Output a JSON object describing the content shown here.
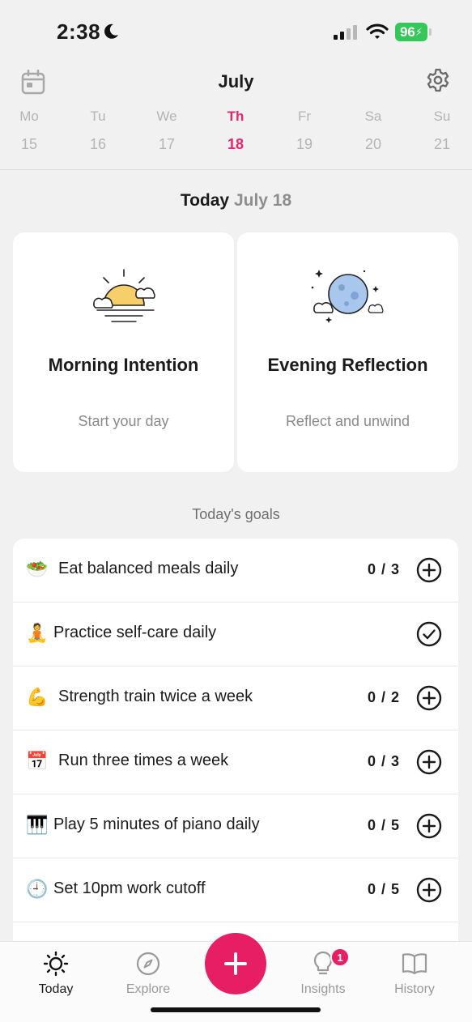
{
  "status_bar": {
    "time": "2:38",
    "battery": "96"
  },
  "header": {
    "month": "July"
  },
  "week": [
    {
      "name": "Mo",
      "num": "15",
      "active": false
    },
    {
      "name": "Tu",
      "num": "16",
      "active": false
    },
    {
      "name": "We",
      "num": "17",
      "active": false
    },
    {
      "name": "Th",
      "num": "18",
      "active": true
    },
    {
      "name": "Fr",
      "num": "19",
      "active": false
    },
    {
      "name": "Sa",
      "num": "20",
      "active": false
    },
    {
      "name": "Su",
      "num": "21",
      "active": false
    }
  ],
  "today": {
    "label": "Today",
    "date": "July 18"
  },
  "cards": {
    "morning": {
      "title": "Morning Intention",
      "subtitle": "Start your day",
      "icon": "sunrise-icon"
    },
    "evening": {
      "title": "Evening Reflection",
      "subtitle": "Reflect and unwind",
      "icon": "moon-icon"
    }
  },
  "goals": {
    "title": "Today's goals",
    "items": [
      {
        "emoji": "🥗",
        "label": "Eat balanced meals daily",
        "count": "0 / 3",
        "action": "add"
      },
      {
        "emoji": "🧘",
        "label": "Practice self-care daily",
        "count": "",
        "action": "done"
      },
      {
        "emoji": "💪",
        "label": "Strength train twice a week",
        "count": "0 / 2",
        "action": "add"
      },
      {
        "emoji": "📅",
        "label": "Run three times a week",
        "count": "0 / 3",
        "action": "add"
      },
      {
        "emoji": "🎹",
        "label": "Play 5 minutes of piano daily",
        "count": "0 / 5",
        "action": "add"
      },
      {
        "emoji": "🕘",
        "label": "Set 10pm work cutoff",
        "count": "0 / 5",
        "action": "add"
      }
    ]
  },
  "tabs": {
    "today": "Today",
    "explore": "Explore",
    "insights": "Insights",
    "history": "History",
    "insights_badge": "1"
  },
  "colors": {
    "accent": "#e81e64",
    "active_day": "#e5266b",
    "battery": "#34c759"
  }
}
